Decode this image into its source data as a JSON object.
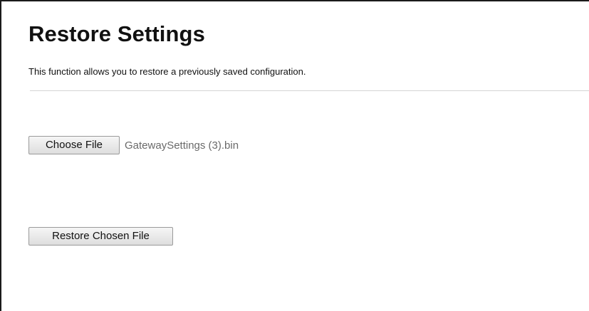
{
  "page": {
    "title": "Restore Settings",
    "description": "This function allows you to restore a previously saved configuration."
  },
  "file_input": {
    "button_label": "Choose File",
    "selected_file": "GatewaySettings (3).bin"
  },
  "actions": {
    "restore_label": "Restore Chosen File"
  }
}
